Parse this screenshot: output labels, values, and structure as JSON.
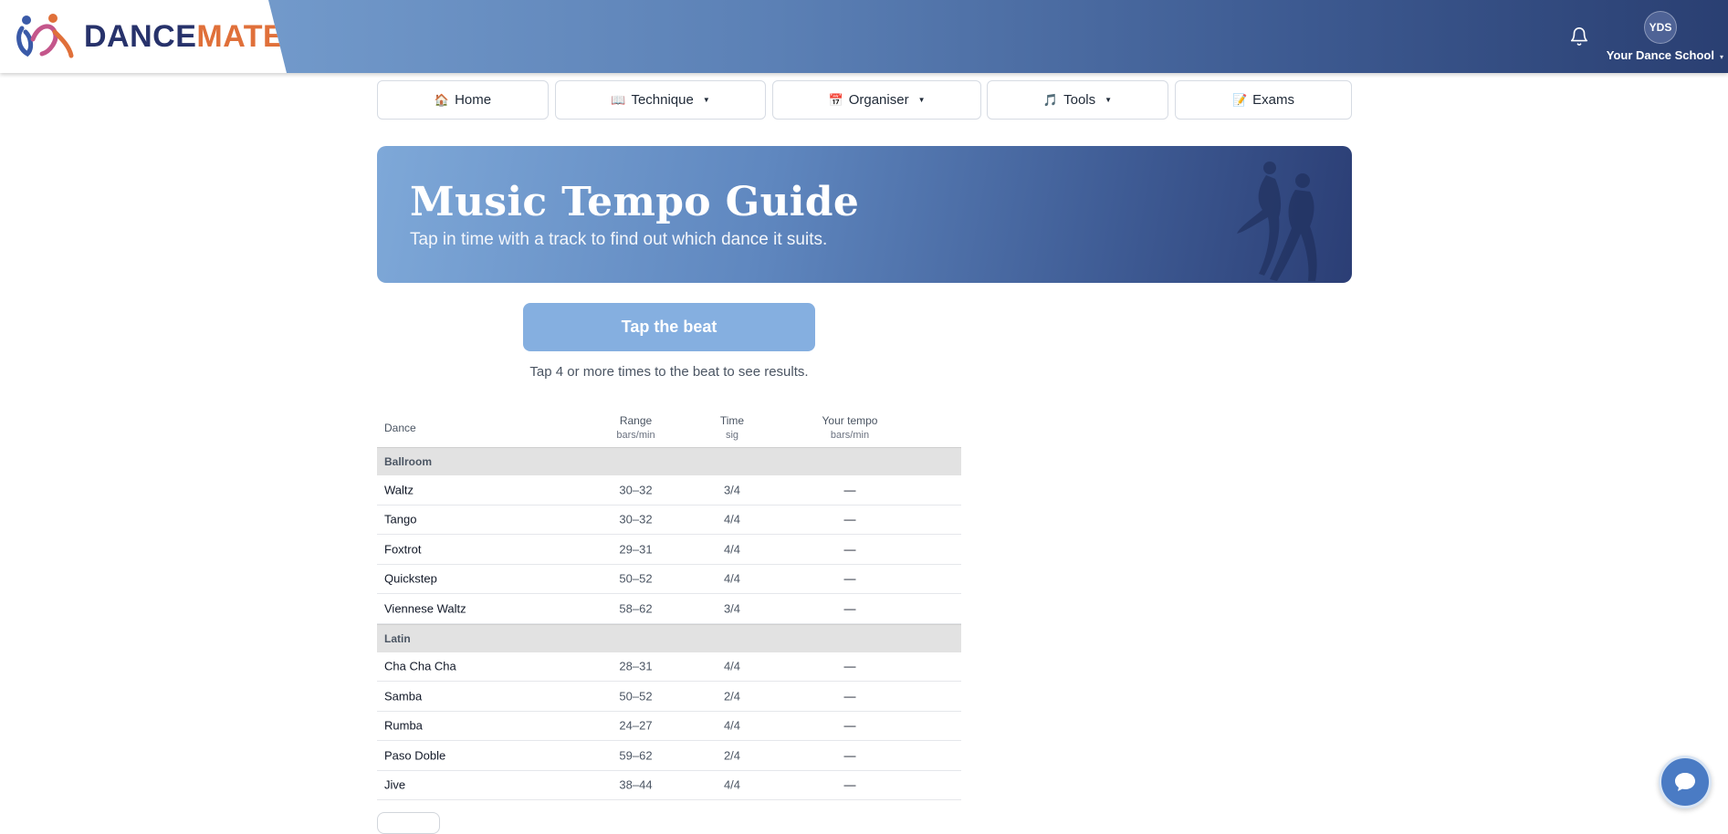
{
  "header": {
    "logo": {
      "part1": "DANCE",
      "part2": "MATE"
    },
    "avatar_initials": "YDS",
    "school_name": "Your Dance School",
    "school_caret": "▾",
    "bell_icon": "bell-icon"
  },
  "nav": [
    {
      "label": "Home",
      "icon": "🏠",
      "dropdown": ""
    },
    {
      "label": "Technique",
      "icon": "📖",
      "dropdown": "▼"
    },
    {
      "label": "Organiser",
      "icon": "📅",
      "dropdown": "▼"
    },
    {
      "label": "Tools",
      "icon": "🎵",
      "dropdown": "▼"
    },
    {
      "label": "Exams",
      "icon": "📝",
      "dropdown": ""
    }
  ],
  "hero": {
    "title": "Music Tempo Guide",
    "subtitle": "Tap in time with a track to find out which dance it suits."
  },
  "tap": {
    "button": "Tap the beat",
    "hint": "Tap 4 or more times to the beat to see results."
  },
  "table": {
    "headers": {
      "dance": "Dance",
      "range": "Range",
      "range_sub": "bars/min",
      "time": "Time",
      "time_sub": "sig",
      "yours": "Your tempo",
      "yours_sub": "bars/min"
    },
    "groups": [
      {
        "name": "Ballroom",
        "rows": [
          {
            "dance": "Waltz",
            "range": "30–32",
            "sig": "3/4",
            "yours": "—"
          },
          {
            "dance": "Tango",
            "range": "30–32",
            "sig": "4/4",
            "yours": "—"
          },
          {
            "dance": "Foxtrot",
            "range": "29–31",
            "sig": "4/4",
            "yours": "—"
          },
          {
            "dance": "Quickstep",
            "range": "50–52",
            "sig": "4/4",
            "yours": "—"
          },
          {
            "dance": "Viennese Waltz",
            "range": "58–62",
            "sig": "3/4",
            "yours": "—"
          }
        ]
      },
      {
        "name": "Latin",
        "rows": [
          {
            "dance": "Cha Cha Cha",
            "range": "28–31",
            "sig": "4/4",
            "yours": "—"
          },
          {
            "dance": "Samba",
            "range": "50–52",
            "sig": "2/4",
            "yours": "—"
          },
          {
            "dance": "Rumba",
            "range": "24–27",
            "sig": "4/4",
            "yours": "—"
          },
          {
            "dance": "Paso Doble",
            "range": "59–62",
            "sig": "2/4",
            "yours": "—"
          },
          {
            "dance": "Jive",
            "range": "38–44",
            "sig": "4/4",
            "yours": "—"
          }
        ]
      }
    ]
  },
  "colors": {
    "accent": "#85afe0",
    "header_dark": "#2a3f72",
    "brand_orange": "#e0703a",
    "brand_navy": "#27326b"
  }
}
